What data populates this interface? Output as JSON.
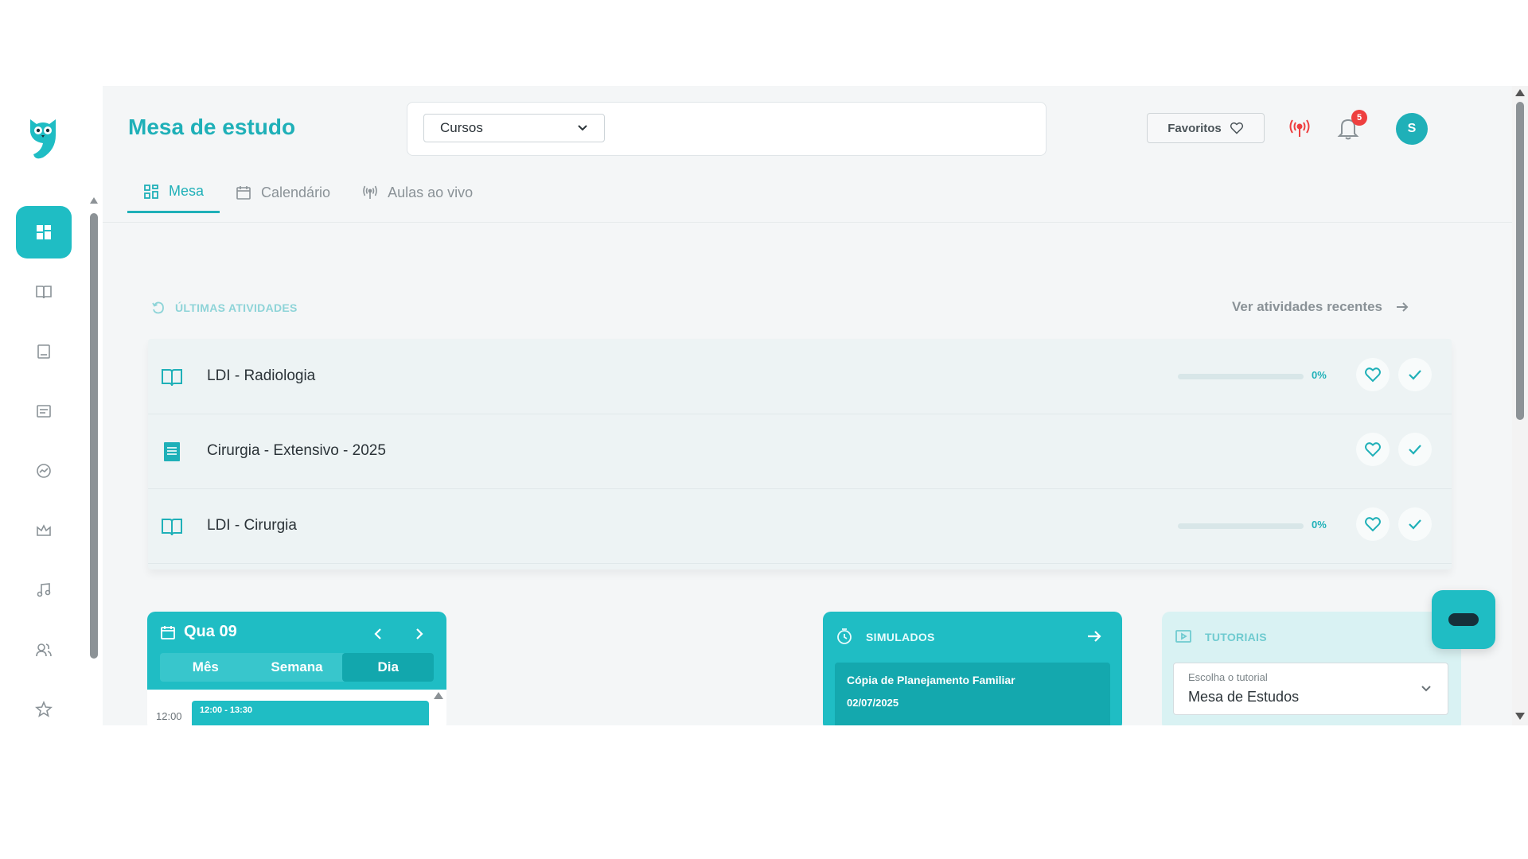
{
  "header": {
    "title": "Mesa de estudo",
    "course_select": "Cursos",
    "favorites_label": "Favoritos",
    "notifications_count": "5",
    "avatar_initial": "S"
  },
  "tabs": [
    {
      "label": "Mesa",
      "icon": "grid-icon",
      "active": true
    },
    {
      "label": "Calendário",
      "icon": "calendar-icon",
      "active": false
    },
    {
      "label": "Aulas ao vivo",
      "icon": "live-icon",
      "active": false
    }
  ],
  "sidebar": {
    "items": [
      {
        "icon": "dashboard-icon",
        "active": true
      },
      {
        "icon": "open-book-icon"
      },
      {
        "icon": "notebook-icon"
      },
      {
        "icon": "document-icon"
      },
      {
        "icon": "chart-icon"
      },
      {
        "icon": "crown-icon"
      },
      {
        "icon": "music-note-icon"
      },
      {
        "icon": "users-icon"
      },
      {
        "icon": "star-icon"
      }
    ]
  },
  "activities": {
    "title": "ÚLTIMAS ATIVIDADES",
    "link": "Ver atividades recentes",
    "items": [
      {
        "name": "LDI - Radiologia",
        "icon": "open-book-icon",
        "progress": "0%",
        "progress_value": 0,
        "show_progress": true
      },
      {
        "name": "Cirurgia - Extensivo - 2025",
        "icon": "notebook-icon",
        "show_progress": false
      },
      {
        "name": "LDI - Cirurgia",
        "icon": "open-book-icon",
        "progress": "0%",
        "progress_value": 0,
        "show_progress": true
      }
    ]
  },
  "calendar": {
    "date": "Qua 09",
    "views": [
      "Mês",
      "Semana",
      "Dia"
    ],
    "active_view": "Dia",
    "time": "12:00",
    "event_time": "12:00 - 13:30"
  },
  "simulados": {
    "title": "SIMULADOS",
    "item_title": "Cópia de Planejamento Familiar",
    "item_date": "02/07/2025"
  },
  "tutoriais": {
    "title": "TUTORIAIS",
    "select_label": "Escolha o tutorial",
    "select_value": "Mesa de Estudos"
  },
  "colors": {
    "accent": "#1fbdc4",
    "title": "#1fb0b8",
    "badge": "#ee3f3f",
    "live": "#ee3f3f"
  }
}
